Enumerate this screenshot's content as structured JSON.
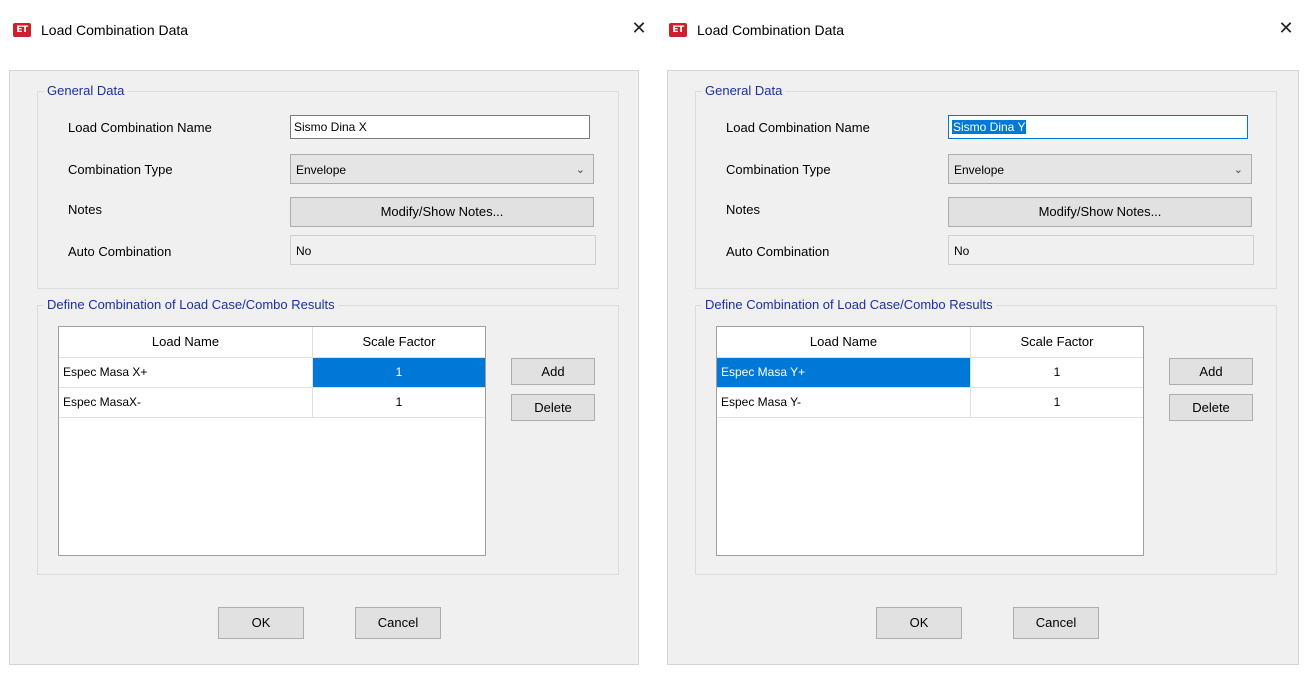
{
  "dialogs": [
    {
      "title": "Load Combination Data",
      "app_icon_text": "ET",
      "close_glyph": "✕",
      "general_data": {
        "group_title": "General Data",
        "name_label": "Load Combination Name",
        "name_value": "Sismo Dina X",
        "name_value_selected": false,
        "type_label": "Combination Type",
        "type_value": "Envelope",
        "notes_label": "Notes",
        "notes_button": "Modify/Show Notes...",
        "auto_label": "Auto Combination",
        "auto_value": "No"
      },
      "define_combination": {
        "group_title": "Define Combination of Load Case/Combo Results",
        "columns": [
          "Load Name",
          "Scale Factor"
        ],
        "rows": [
          {
            "load_name": "Espec Masa X+",
            "scale_factor": "1"
          },
          {
            "load_name": "Espec MasaX-",
            "scale_factor": "1"
          }
        ],
        "selected_cell": "r0-scale",
        "add_button": "Add",
        "delete_button": "Delete"
      },
      "ok_button": "OK",
      "cancel_button": "Cancel"
    },
    {
      "title": "Load Combination Data",
      "app_icon_text": "ET",
      "close_glyph": "✕",
      "general_data": {
        "group_title": "General Data",
        "name_label": "Load Combination Name",
        "name_value": "Sismo Dina Y",
        "name_value_selected": true,
        "type_label": "Combination Type",
        "type_value": "Envelope",
        "notes_label": "Notes",
        "notes_button": "Modify/Show Notes...",
        "auto_label": "Auto Combination",
        "auto_value": "No"
      },
      "define_combination": {
        "group_title": "Define Combination of Load Case/Combo Results",
        "columns": [
          "Load Name",
          "Scale Factor"
        ],
        "rows": [
          {
            "load_name": "Espec Masa Y+",
            "scale_factor": "1"
          },
          {
            "load_name": "Espec Masa Y-",
            "scale_factor": "1"
          }
        ],
        "selected_cell": "r0-name",
        "add_button": "Add",
        "delete_button": "Delete"
      },
      "ok_button": "OK",
      "cancel_button": "Cancel"
    }
  ],
  "colors": {
    "selection": "#0078d7",
    "group_title": "#1b2fa3",
    "app_icon": "#cf1f2e",
    "dialog_body": "#f0f0f0"
  },
  "icons": {
    "app": "etabs-app-icon",
    "close": "close-icon",
    "dropdown": "chevron-down-icon"
  }
}
